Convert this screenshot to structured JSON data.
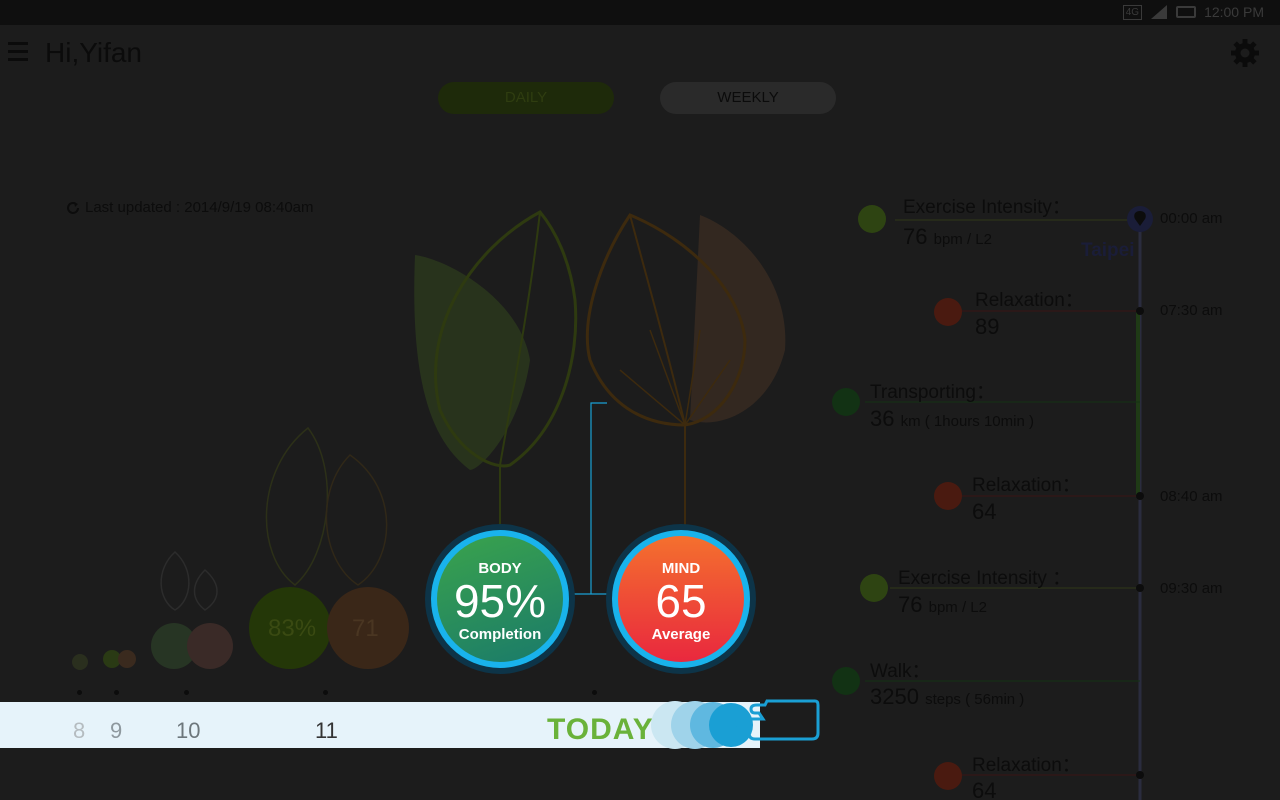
{
  "status": {
    "network": "4G",
    "time": "12:00 PM"
  },
  "app": {
    "greeting": "Hi,Yifan"
  },
  "tabs": {
    "daily": "DAILY",
    "weekly": "WEEKLY"
  },
  "last_updated": "Last updated : 2014/9/19 08:40am",
  "history_labels": [
    "83%",
    "71"
  ],
  "body": {
    "title": "BODY",
    "value": "95%",
    "subtitle": "Completion"
  },
  "mind": {
    "title": "MIND",
    "value": "65",
    "subtitle": "Average"
  },
  "dates": [
    "8",
    "9",
    "10",
    "11"
  ],
  "today_label": "TODAY",
  "timeline": {
    "city": "Taipei",
    "times": [
      "00:00 am",
      "07:30 am",
      "08:40 am",
      "09:30 am"
    ],
    "events": [
      {
        "title": "Exercise Intensity：",
        "value": "76",
        "unit": "bpm / L2",
        "icon": "heart-icon"
      },
      {
        "title": "Relaxation：",
        "value": "89",
        "unit": "",
        "icon": "smile-icon"
      },
      {
        "title": "Transporting：",
        "value": "36",
        "unit": "km (  1hours 10min )",
        "icon": "transport-icon"
      },
      {
        "title": "Relaxation：",
        "value": "64",
        "unit": "",
        "icon": "smile-icon"
      },
      {
        "title": "Exercise Intensity ：",
        "value": "76",
        "unit": "bpm / L2",
        "icon": "heart-icon"
      },
      {
        "title": "Walk：",
        "value": "3250",
        "unit": "steps ( 56min )",
        "icon": "walk-icon"
      },
      {
        "title": "Relaxation：",
        "value": "64",
        "unit": "",
        "icon": "smile-icon"
      }
    ]
  },
  "colors": {
    "body_green": "#3aa34c",
    "mind_red": "#e9283e",
    "ring_blue": "#19b3ec",
    "today_green": "#6ab23a"
  }
}
